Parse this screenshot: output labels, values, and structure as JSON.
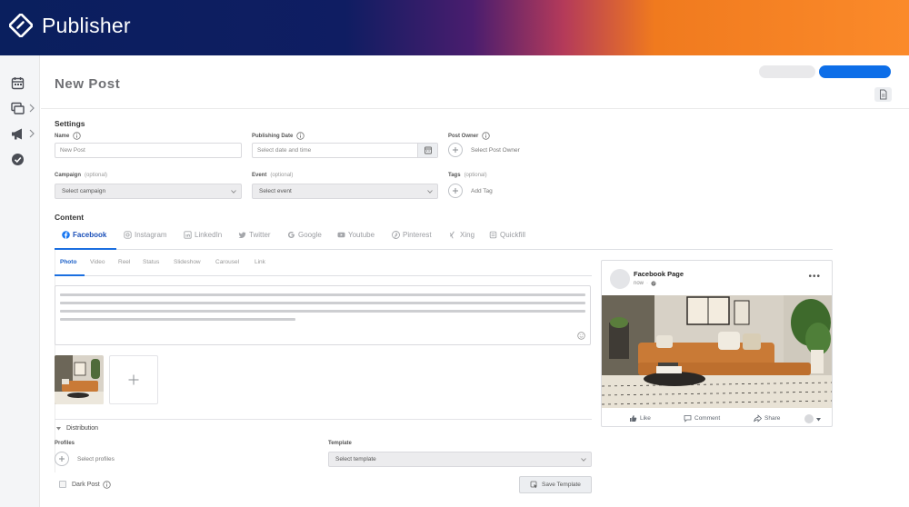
{
  "app": {
    "brand": "Publisher",
    "brand_color": "#0a1f5e",
    "accent_color": "#f07a1e",
    "primary_color": "#0d6ee8"
  },
  "sidebar": {
    "items": [
      {
        "icon": "calendar-icon"
      },
      {
        "icon": "stack-icon",
        "expandable": true
      },
      {
        "icon": "megaphone-icon",
        "expandable": true
      },
      {
        "icon": "check-circle-icon"
      }
    ]
  },
  "page": {
    "title": "New Post"
  },
  "settings": {
    "title": "Settings",
    "name": {
      "label": "Name",
      "placeholder": "New Post"
    },
    "publishing_date": {
      "label": "Publishing Date",
      "placeholder": "Select date and time"
    },
    "post_owner": {
      "label": "Post Owner",
      "action": "Select Post Owner"
    },
    "campaign": {
      "label": "Campaign",
      "optional": "(optional)",
      "value": "Select campaign"
    },
    "event": {
      "label": "Event",
      "optional": "(optional)",
      "value": "Select event"
    },
    "tags": {
      "label": "Tags",
      "optional": "(optional)",
      "action": "Add Tag"
    }
  },
  "content": {
    "title": "Content",
    "networks": [
      {
        "label": "Facebook",
        "icon": "facebook-icon",
        "active": true
      },
      {
        "label": "Instagram",
        "icon": "instagram-icon"
      },
      {
        "label": "LinkedIn",
        "icon": "linkedin-icon"
      },
      {
        "label": "Twitter",
        "icon": "twitter-icon"
      },
      {
        "label": "Google",
        "icon": "google-icon"
      },
      {
        "label": "Youtube",
        "icon": "youtube-icon"
      },
      {
        "label": "Pinterest",
        "icon": "pinterest-icon"
      },
      {
        "label": "Xing",
        "icon": "xing-icon"
      },
      {
        "label": "Quickfill",
        "icon": "quickfill-icon"
      }
    ],
    "types": [
      {
        "label": "Photo",
        "active": true
      },
      {
        "label": "Video"
      },
      {
        "label": "Reel"
      },
      {
        "label": "Status"
      },
      {
        "label": "Slideshow"
      },
      {
        "label": "Carousel"
      },
      {
        "label": "Link"
      }
    ]
  },
  "distribution": {
    "title": "Distribution",
    "profiles": {
      "label": "Profiles",
      "action": "Select profiles"
    },
    "template": {
      "label": "Template",
      "value": "Select template"
    },
    "dark_post": {
      "label": "Dark Post",
      "checked": false
    },
    "save_template": "Save Template"
  },
  "preview": {
    "page_name": "Facebook Page",
    "time": "now",
    "actions": {
      "like": "Like",
      "comment": "Comment",
      "share": "Share"
    }
  }
}
